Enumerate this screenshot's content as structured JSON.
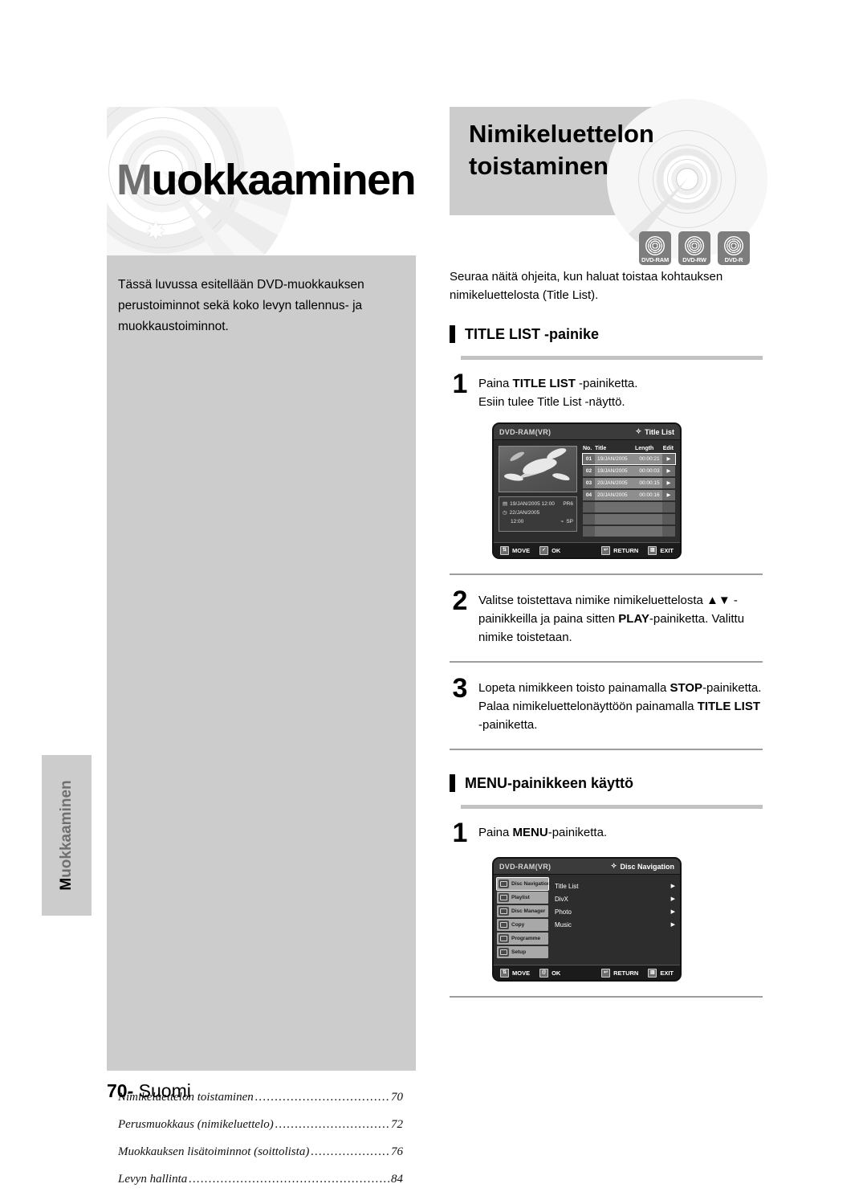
{
  "left": {
    "hero_title_cap": "M",
    "hero_title_rest": "uokkaaminen",
    "intro": "Tässä luvussa esitellään DVD-muokkauksen perustoiminnot sekä koko levyn tallennus- ja muokkaustoiminnot.",
    "side_tab_cap": "M",
    "side_tab_rest": "uokkaaminen",
    "toc": [
      {
        "label": "Nimikeluettelon toistaminen",
        "page": "70"
      },
      {
        "label": "Perusmuokkaus (nimikeluettelo)",
        "page": "72"
      },
      {
        "label": "Muokkauksen lisätoiminnot (soittolista)",
        "page": "76"
      },
      {
        "label": "Levyn hallinta",
        "page": "84"
      }
    ]
  },
  "footer": {
    "page_number": "70",
    "separator": "-",
    "language": "Suomi"
  },
  "right": {
    "title_line1": "Nimikeluettelon",
    "title_line2": "toistaminen",
    "badges": [
      {
        "label": "DVD-RAM",
        "icon": "disc-icon"
      },
      {
        "label": "DVD-RW",
        "icon": "disc-icon"
      },
      {
        "label": "DVD-R",
        "icon": "disc-icon"
      }
    ],
    "intro": "Seuraa näitä ohjeita, kun haluat toistaa kohtauksen nimikeluettelosta (Title List).",
    "section1": {
      "heading": "TITLE LIST -painike",
      "step1_num": "1",
      "step1_line1_a": "Paina ",
      "step1_line1_b": "TITLE LIST",
      "step1_line1_c": " -painiketta.",
      "step1_line2": "Esiin tulee Title List -näyttö.",
      "step2_num": "2",
      "step2_a": "Valitse toistettava nimike nimikeluettelosta ▲▼ -painikkeilla ja paina sitten ",
      "step2_b": "PLAY",
      "step2_c": "-painiketta. Valittu nimike toistetaan.",
      "step3_num": "3",
      "step3_a": "Lopeta nimikkeen toisto painamalla ",
      "step3_b": "STOP",
      "step3_c": "-painiketta.",
      "step3_d": "Palaa nimikeluettelonäyttöön painamalla ",
      "step3_e": "TITLE LIST",
      "step3_f": " -painiketta."
    },
    "section2": {
      "heading": "MENU-painikkeen käyttö",
      "step1_num": "1",
      "step1_a": "Paina ",
      "step1_b": "MENU",
      "step1_c": "-painiketta."
    }
  },
  "osd_title_list": {
    "disc_type": "DVD-RAM(VR)",
    "screen_label": "Title List",
    "screen_label_icon": "diamond-icon",
    "columns": {
      "no": "No.",
      "title": "Title",
      "length": "Length",
      "edit": "Edit"
    },
    "rows": [
      {
        "no": "01",
        "title": "19/JAN/2005",
        "length": "00:00:21",
        "edit": "▶",
        "selected": true
      },
      {
        "no": "02",
        "title": "19/JAN/2005",
        "length": "00:00:03",
        "edit": "▶",
        "selected": false
      },
      {
        "no": "03",
        "title": "20/JAN/2005",
        "length": "00:00:15",
        "edit": "▶",
        "selected": false
      },
      {
        "no": "04",
        "title": "20/JAN/2005",
        "length": "00:00:16",
        "edit": "▶",
        "selected": false
      }
    ],
    "empty_rows": 4,
    "info": {
      "line1_icon": "calendar-icon",
      "line1": "19/JAN/2005 12:00",
      "line1_right": "PR6",
      "line2_icon": "clock-icon",
      "line2": "22/JAN/2005",
      "line3": "12:00",
      "line3_icon": "lock-icon",
      "line3_right": "SP"
    },
    "buttons": [
      {
        "label": "MOVE",
        "icon": "updown-icon",
        "glyph": "⇅"
      },
      {
        "label": "OK",
        "icon": "ok-icon",
        "glyph": "✓"
      },
      {
        "label": "RETURN",
        "icon": "return-icon",
        "glyph": "↩"
      },
      {
        "label": "EXIT",
        "icon": "exit-icon",
        "glyph": "▥"
      }
    ]
  },
  "osd_disc_navigation": {
    "disc_type": "DVD-RAM(VR)",
    "screen_label": "Disc Navigation",
    "screen_label_icon": "diamond-icon",
    "sidebar": [
      {
        "label": "Disc Navigation",
        "icon": "disc-navigation-icon",
        "selected": true
      },
      {
        "label": "Playlist",
        "icon": "playlist-icon",
        "selected": false
      },
      {
        "label": "Disc Manager",
        "icon": "disc-manager-icon",
        "selected": false
      },
      {
        "label": "Copy",
        "icon": "copy-icon",
        "selected": false
      },
      {
        "label": "Programme",
        "icon": "programme-icon",
        "selected": false
      },
      {
        "label": "Setup",
        "icon": "setup-icon",
        "selected": false
      }
    ],
    "menu": [
      {
        "label": "Title List",
        "arrow": "▶"
      },
      {
        "label": "DivX",
        "arrow": "▶"
      },
      {
        "label": "Photo",
        "arrow": "▶"
      },
      {
        "label": "Music",
        "arrow": "▶"
      }
    ],
    "buttons": [
      {
        "label": "MOVE",
        "icon": "updown-icon",
        "glyph": "⇅"
      },
      {
        "label": "OK",
        "icon": "ok-icon",
        "glyph": "@"
      },
      {
        "label": "RETURN",
        "icon": "return-icon",
        "glyph": "↩"
      },
      {
        "label": "EXIT",
        "icon": "exit-icon",
        "glyph": "▥"
      }
    ]
  },
  "colors": {
    "panel_gray": "#cccccc",
    "rule_gray": "#c2c2c2",
    "osd_bg": "#2d2d2d",
    "badge_gray": "#7d7d7d"
  }
}
